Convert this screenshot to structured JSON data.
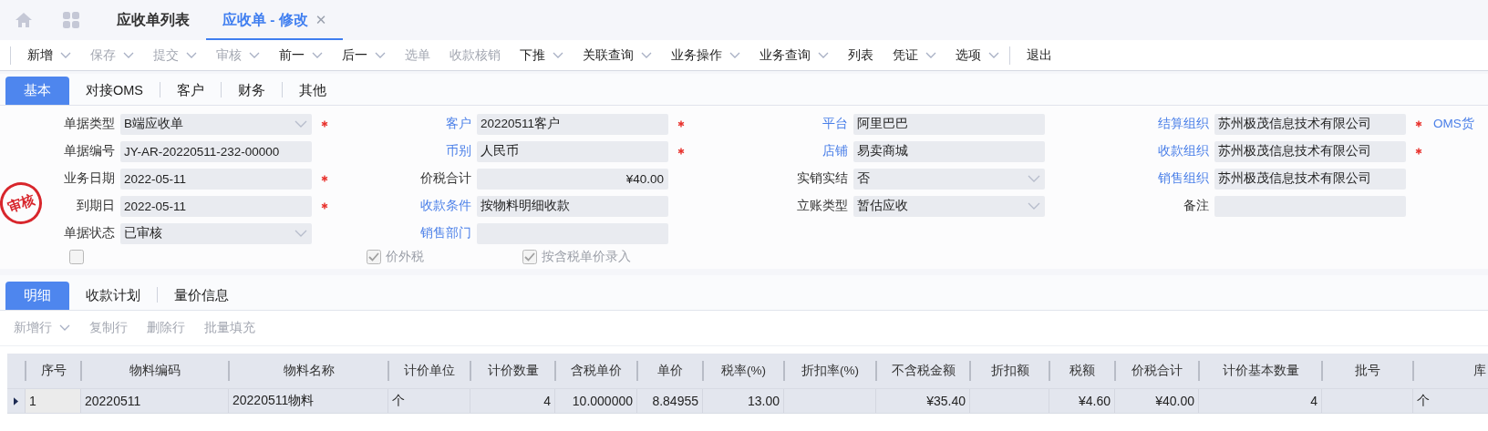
{
  "page_tabs": [
    {
      "label": "应收单列表",
      "selected": false,
      "closable": false
    },
    {
      "label": "应收单 - 修改",
      "selected": true,
      "closable": true,
      "close": "✕"
    }
  ],
  "toolbar": [
    {
      "label": "新增",
      "dropdown": true,
      "disabled": false
    },
    {
      "label": "保存",
      "dropdown": true,
      "disabled": true
    },
    {
      "label": "提交",
      "dropdown": true,
      "disabled": true
    },
    {
      "label": "审核",
      "dropdown": true,
      "disabled": true
    },
    {
      "label": "前一",
      "dropdown": true,
      "disabled": false
    },
    {
      "label": "后一",
      "dropdown": true,
      "disabled": false
    },
    {
      "label": "选单",
      "dropdown": false,
      "disabled": true
    },
    {
      "label": "收款核销",
      "dropdown": false,
      "disabled": true
    },
    {
      "label": "下推",
      "dropdown": true,
      "disabled": false
    },
    {
      "label": "关联查询",
      "dropdown": true,
      "disabled": false
    },
    {
      "label": "业务操作",
      "dropdown": true,
      "disabled": false
    },
    {
      "label": "业务查询",
      "dropdown": true,
      "disabled": false
    },
    {
      "label": "列表",
      "dropdown": false,
      "disabled": false
    },
    {
      "label": "凭证",
      "dropdown": true,
      "disabled": false
    },
    {
      "label": "选项",
      "dropdown": true,
      "disabled": false
    },
    {
      "kind": "separator"
    },
    {
      "label": "退出",
      "dropdown": false,
      "disabled": false
    }
  ],
  "form_tabs": [
    {
      "label": "基本",
      "selected": true
    },
    {
      "label": "对接OMS",
      "selected": false
    },
    {
      "label": "客户",
      "selected": false
    },
    {
      "label": "财务",
      "selected": false
    },
    {
      "label": "其他",
      "selected": false
    }
  ],
  "stamp": "审核",
  "form_rows": [
    [
      {
        "kind": "select",
        "label": "单据类型",
        "link": false,
        "value": "B端应收单",
        "required": true
      },
      {
        "kind": "text",
        "label": "客户",
        "link": true,
        "value": "20220511客户",
        "required": true
      },
      {
        "kind": "text",
        "label": "平台",
        "link": true,
        "value": "阿里巴巴",
        "required": false
      },
      {
        "kind": "text",
        "label": "结算组织",
        "link": true,
        "value": "苏州极茂信息技术有限公司",
        "required": true
      },
      {
        "kind": "label",
        "label": "OMS货",
        "link": true,
        "required": false
      }
    ],
    [
      {
        "kind": "text",
        "label": "单据编号",
        "link": false,
        "value": "JY-AR-20220511-232-00000",
        "required": false
      },
      {
        "kind": "text",
        "label": "币别",
        "link": true,
        "value": "人民币",
        "required": true
      },
      {
        "kind": "text",
        "label": "店铺",
        "link": true,
        "value": "易卖商城",
        "required": false
      },
      {
        "kind": "text",
        "label": "收款组织",
        "link": true,
        "value": "苏州极茂信息技术有限公司",
        "required": true
      }
    ],
    [
      {
        "kind": "text",
        "label": "业务日期",
        "link": false,
        "value": "2022-05-11",
        "required": true
      },
      {
        "kind": "amount",
        "label": "价税合计",
        "link": false,
        "value": "¥40.00",
        "required": false
      },
      {
        "kind": "select",
        "label": "实销实结",
        "link": false,
        "value": "否",
        "required": false
      },
      {
        "kind": "text",
        "label": "销售组织",
        "link": true,
        "value": "苏州极茂信息技术有限公司",
        "required": false
      }
    ],
    [
      {
        "kind": "text",
        "label": "到期日",
        "link": false,
        "value": "2022-05-11",
        "required": true
      },
      {
        "kind": "text",
        "label": "收款条件",
        "link": true,
        "value": "按物料明细收款",
        "required": false
      },
      {
        "kind": "select",
        "label": "立账类型",
        "link": false,
        "value": "暂估应收",
        "required": false
      },
      {
        "kind": "text",
        "label": "备注",
        "link": false,
        "required": false
      }
    ],
    [
      {
        "kind": "select",
        "label": "单据状态",
        "link": false,
        "value": "已审核",
        "required": false
      },
      {
        "kind": "text",
        "label": "销售部门",
        "link": true,
        "required": false
      }
    ]
  ],
  "checkboxes": [
    {
      "checked": false
    },
    {
      "label": "价外税",
      "checked": true
    },
    {
      "label": "按含税单价录入",
      "checked": true
    }
  ],
  "detail_tabs": [
    {
      "label": "明细",
      "selected": true
    },
    {
      "label": "收款计划",
      "selected": false
    },
    {
      "label": "量价信息",
      "selected": false
    }
  ],
  "detail_toolbar": [
    {
      "label": "新增行",
      "dropdown": true,
      "disabled": true
    },
    {
      "label": "复制行",
      "dropdown": false,
      "disabled": true
    },
    {
      "label": "删除行",
      "dropdown": false,
      "disabled": true
    },
    {
      "label": "批量填充",
      "dropdown": false,
      "disabled": true
    }
  ],
  "table": {
    "columns": [
      "序号",
      "物料编码",
      "物料名称",
      "计价单位",
      "计价数量",
      "含税单价",
      "单价",
      "税率(%)",
      "折扣率(%)",
      "不含税金额",
      "折扣额",
      "税额",
      "价税合计",
      "计价基本数量",
      "批号",
      "库"
    ],
    "rows": [
      {
        "current": true,
        "cells": [
          "1",
          "20220511",
          "20220511物料",
          "个",
          "4",
          "10.000000",
          "8.84955",
          "13.00",
          "",
          "¥35.40",
          "",
          "¥4.60",
          "¥40.00",
          "4",
          "",
          "个"
        ]
      }
    ]
  }
}
